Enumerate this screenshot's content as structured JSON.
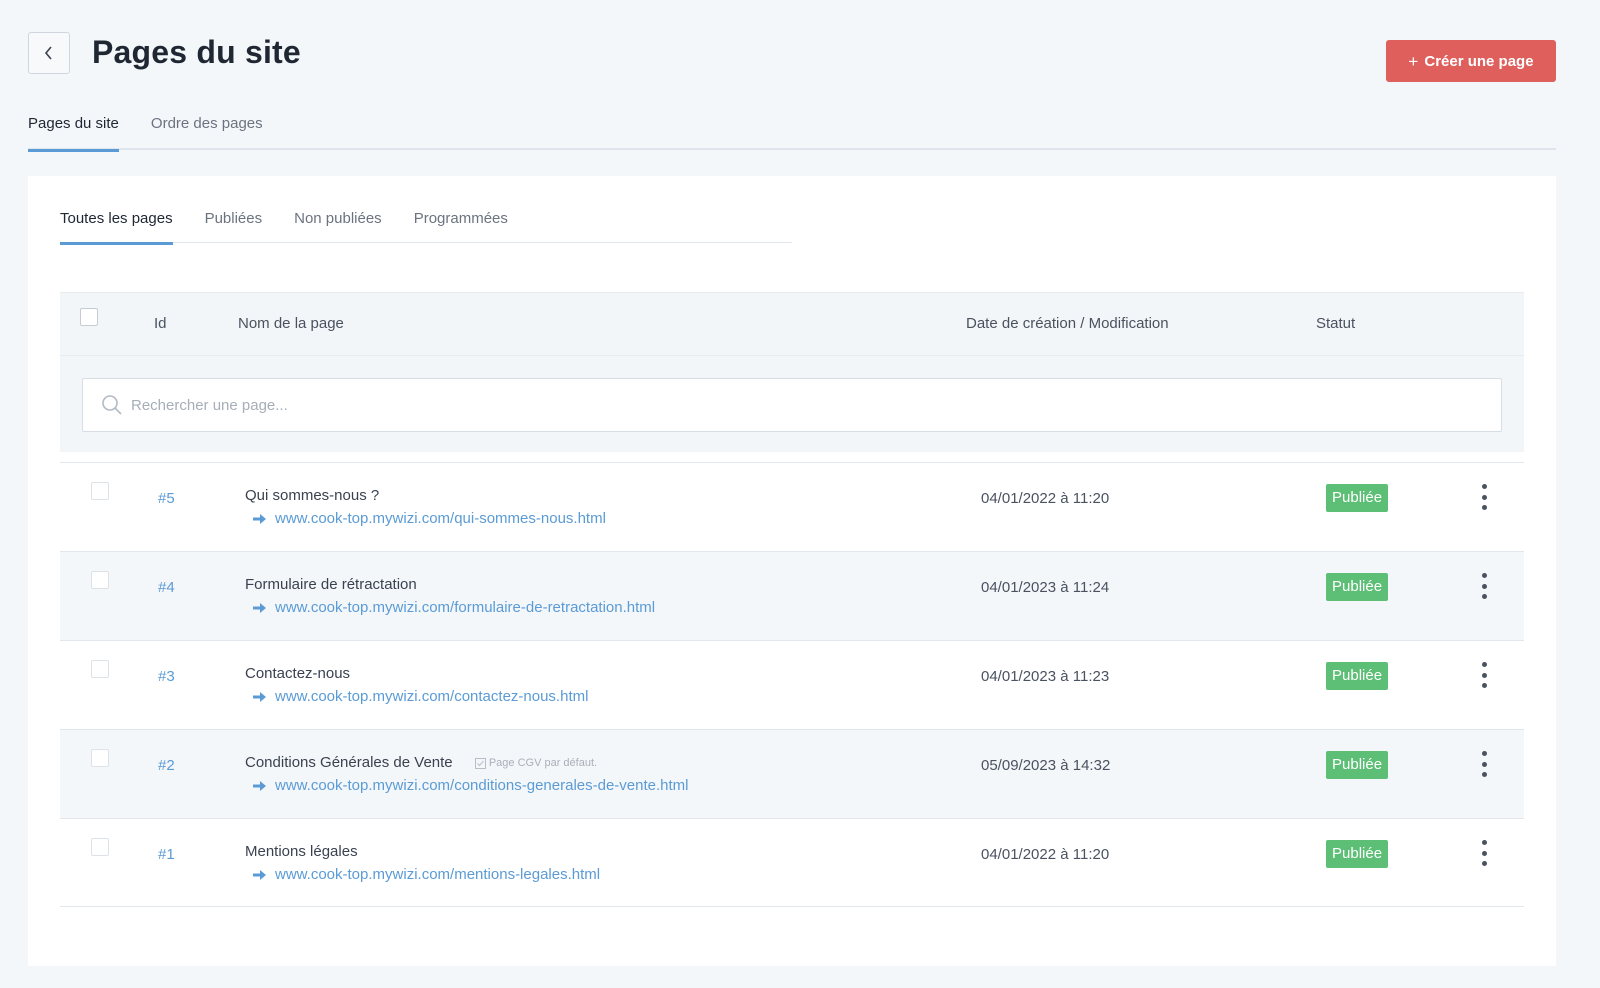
{
  "header": {
    "title": "Pages du site",
    "create_label": "Créer une page",
    "accent_color": "#de5f5c"
  },
  "top_tabs": [
    {
      "label": "Pages du site",
      "active": true
    },
    {
      "label": "Ordre des pages",
      "active": false
    }
  ],
  "sub_tabs": [
    {
      "label": "Toutes les pages",
      "active": true
    },
    {
      "label": "Publiées",
      "active": false
    },
    {
      "label": "Non publiées",
      "active": false
    },
    {
      "label": "Programmées",
      "active": false
    }
  ],
  "table": {
    "columns": {
      "id": "Id",
      "name": "Nom de la page",
      "date": "Date de création / Modification",
      "status": "Statut"
    },
    "search_placeholder": "Rechercher une page...",
    "rows": [
      {
        "id": "#5",
        "name": "Qui sommes-nous ?",
        "url": "www.cook-top.mywizi.com/qui-sommes-nous.html",
        "date": "04/01/2022 à 11:20",
        "status": "Publiée",
        "note": ""
      },
      {
        "id": "#4",
        "name": "Formulaire de rétractation",
        "url": "www.cook-top.mywizi.com/formulaire-de-retractation.html",
        "date": "04/01/2023 à 11:24",
        "status": "Publiée",
        "note": ""
      },
      {
        "id": "#3",
        "name": "Contactez-nous",
        "url": "www.cook-top.mywizi.com/contactez-nous.html",
        "date": "04/01/2023 à 11:23",
        "status": "Publiée",
        "note": ""
      },
      {
        "id": "#2",
        "name": "Conditions Générales de Vente",
        "url": "www.cook-top.mywizi.com/conditions-generales-de-vente.html",
        "date": "05/09/2023 à 14:32",
        "status": "Publiée",
        "note": "Page CGV par défaut."
      },
      {
        "id": "#1",
        "name": "Mentions légales",
        "url": "www.cook-top.mywizi.com/mentions-legales.html",
        "date": "04/01/2022 à 11:20",
        "status": "Publiée",
        "note": ""
      }
    ]
  },
  "colors": {
    "link": "#5b9bd5",
    "published_badge": "#5cbf75",
    "tab_indicator": "#5b9bd5"
  }
}
